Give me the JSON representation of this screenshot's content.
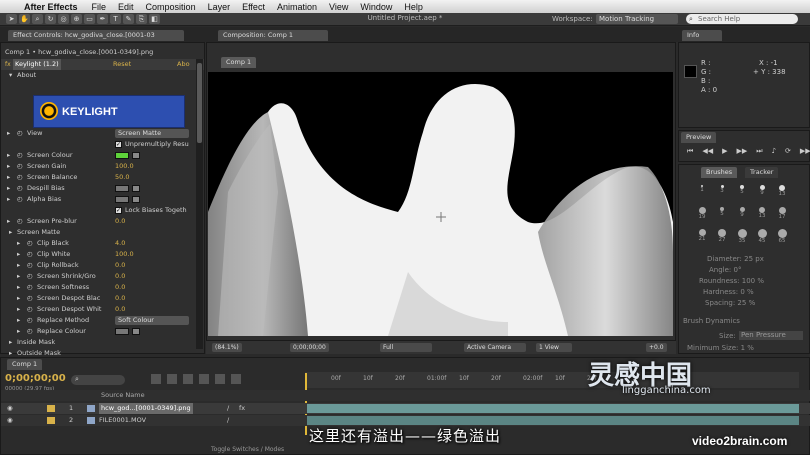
{
  "menubar": {
    "app": "After Effects",
    "items": [
      "File",
      "Edit",
      "Composition",
      "Layer",
      "Effect",
      "Animation",
      "View",
      "Window",
      "Help"
    ]
  },
  "toolbar": {
    "title": "Untitled Project.aep *",
    "workspace_label": "Workspace:",
    "workspace_value": "Motion Tracking",
    "search_placeholder": "Search Help"
  },
  "effect_controls": {
    "tab": "Effect Controls: hcw_godiva_close.[0001-03",
    "breadcrumb": "Comp 1 • hcw_godiva_close.[0001-0349].png",
    "effect_name": "Keylight (1.2)",
    "reset": "Reset",
    "about": "Abo",
    "about_row": "About",
    "logo_text": "KEYLIGHT",
    "rows": [
      {
        "label": "View",
        "value": "Screen Matte",
        "kind": "drop"
      },
      {
        "label": "",
        "value": "Unpremultiply Resu",
        "kind": "check"
      },
      {
        "label": "Screen Colour",
        "kind": "swatch_green"
      },
      {
        "label": "Screen Gain",
        "value": "100.0"
      },
      {
        "label": "Screen Balance",
        "value": "50.0"
      },
      {
        "label": "Despill Bias",
        "kind": "swatch_gray"
      },
      {
        "label": "Alpha Bias",
        "kind": "swatch_gray"
      },
      {
        "label": "",
        "value": "Lock Biases Togeth",
        "kind": "check"
      },
      {
        "label": "Screen Pre-blur",
        "value": "0.0"
      },
      {
        "label": "Screen Matte",
        "kind": "section"
      },
      {
        "label": "Clip Black",
        "value": "4.0"
      },
      {
        "label": "Clip White",
        "value": "100.0"
      },
      {
        "label": "Clip Rollback",
        "value": "0.0"
      },
      {
        "label": "Screen Shrink/Gro",
        "value": "0.0"
      },
      {
        "label": "Screen Softness",
        "value": "0.0"
      },
      {
        "label": "Screen Despot Blac",
        "value": "0.0"
      },
      {
        "label": "Screen Despot Whit",
        "value": "0.0"
      },
      {
        "label": "Replace Method",
        "value": "Soft Colour",
        "kind": "drop"
      },
      {
        "label": "Replace Colour",
        "kind": "swatch_gray"
      },
      {
        "label": "Inside Mask",
        "kind": "section"
      },
      {
        "label": "Outside Mask",
        "kind": "section"
      }
    ]
  },
  "composition": {
    "tab": "Composition: Comp 1",
    "sub_tab": "Comp 1",
    "zoom": "(84.1%)",
    "timecode": "0;00;00;00",
    "resolution": "Full",
    "camera": "Active Camera",
    "views": "1 View",
    "exposure": "+0.0"
  },
  "info": {
    "tab": "Info",
    "channels": [
      "R :",
      "G :",
      "B :",
      "A : 0"
    ],
    "x": "X : -1",
    "y": "+ Y : 338"
  },
  "preview": {
    "tab": "Preview"
  },
  "brushes": {
    "tabs": [
      "Brushes",
      "Tracker"
    ],
    "sizes": [
      "1",
      "3",
      "5",
      "9",
      "13",
      "19",
      "5",
      "9",
      "13",
      "17",
      "21",
      "27",
      "35",
      "45",
      "65"
    ],
    "diameter": "Diameter: 25 px",
    "angle": "Angle: 0°",
    "roundness": "Roundness: 100 %",
    "hardness": "Hardness: 0 %",
    "spacing": "Spacing: 25 %",
    "dynamics": "Brush Dynamics",
    "size_label": "Size:",
    "size_value": "Pen Pressure",
    "min_size": "Minimum Size: 1 %"
  },
  "timeline": {
    "tab": "Comp 1",
    "timecode": "0;00;00;00",
    "fps": "00000 (29.97 fps)",
    "ruler": [
      "00f",
      "10f",
      "20f",
      "01:00f",
      "10f",
      "20f",
      "02:00f",
      "10f",
      "20f"
    ],
    "header_source": "Source Name",
    "layers": [
      {
        "num": "1",
        "name": "hcw_god...[0001-0349].png"
      },
      {
        "num": "2",
        "name": "FILE0001.MOV"
      }
    ],
    "toggle": "Toggle Switches / Modes"
  },
  "subtitle": "这里还有溢出——绿色溢出",
  "watermarks": {
    "logo": "灵感中国",
    "url": "lingganchina.com",
    "v2b": "video2brain.com"
  },
  "colors": {
    "screen_colour": "#5ed23a",
    "accent": "#d8b24a"
  }
}
